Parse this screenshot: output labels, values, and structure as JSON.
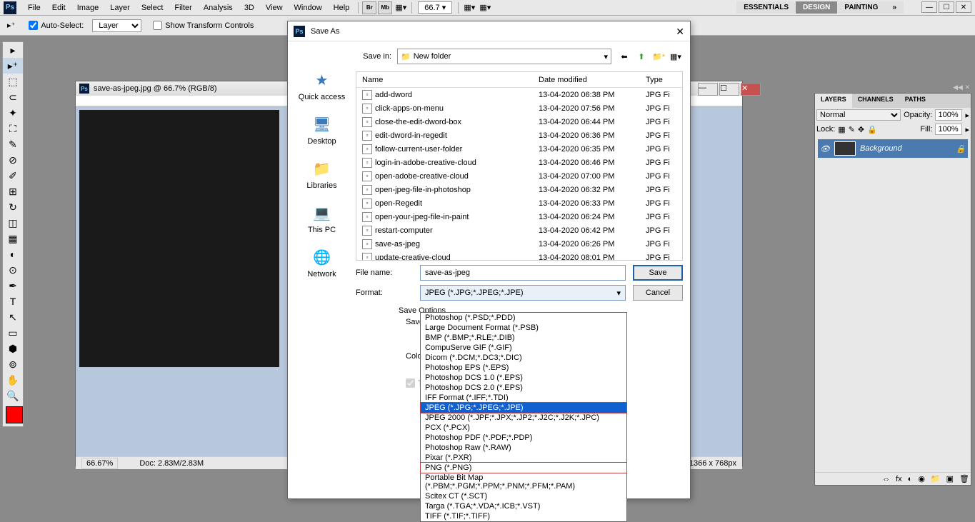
{
  "app": {
    "logo": "Ps"
  },
  "menu": [
    "File",
    "Edit",
    "Image",
    "Layer",
    "Select",
    "Filter",
    "Analysis",
    "3D",
    "View",
    "Window",
    "Help"
  ],
  "zoom": "66.7",
  "workspaces": [
    "ESSENTIALS",
    "DESIGN",
    "PAINTING"
  ],
  "options": {
    "auto_select": "Auto-Select:",
    "auto_select_val": "Layer",
    "show_transform": "Show Transform Controls"
  },
  "doc": {
    "title": "save-as-jpeg.jpg @ 66.7% (RGB/8)",
    "zoom": "66.67%",
    "size": "Doc: 2.83M/2.83M",
    "dims": "1366 x 768px"
  },
  "panels": {
    "tabs": [
      "LAYERS",
      "CHANNELS",
      "PATHS"
    ],
    "blend": "Normal",
    "opacity_lbl": "Opacity:",
    "opacity_val": "100%",
    "lock_lbl": "Lock:",
    "fill_lbl": "Fill:",
    "fill_val": "100%",
    "layer": "Background"
  },
  "dialog": {
    "title": "Save As",
    "savein_lbl": "Save in:",
    "savein_val": "New folder",
    "nav": [
      "Quick access",
      "Desktop",
      "Libraries",
      "This PC",
      "Network"
    ],
    "headers": {
      "name": "Name",
      "date": "Date modified",
      "type": "Type"
    },
    "files": [
      {
        "n": "add-dword",
        "d": "13-04-2020 06:38 PM",
        "t": "JPG Fi"
      },
      {
        "n": "click-apps-on-menu",
        "d": "13-04-2020 07:56 PM",
        "t": "JPG Fi"
      },
      {
        "n": "close-the-edit-dword-box",
        "d": "13-04-2020 06:44 PM",
        "t": "JPG Fi"
      },
      {
        "n": "edit-dword-in-regedit",
        "d": "13-04-2020 06:36 PM",
        "t": "JPG Fi"
      },
      {
        "n": "follow-current-user-folder",
        "d": "13-04-2020 06:35 PM",
        "t": "JPG Fi"
      },
      {
        "n": "login-in-adobe-creative-cloud",
        "d": "13-04-2020 06:46 PM",
        "t": "JPG Fi"
      },
      {
        "n": "open-adobe-creative-cloud",
        "d": "13-04-2020 07:00 PM",
        "t": "JPG Fi"
      },
      {
        "n": "open-jpeg-file-in-photoshop",
        "d": "13-04-2020 06:32 PM",
        "t": "JPG Fi"
      },
      {
        "n": "open-Regedit",
        "d": "13-04-2020 06:33 PM",
        "t": "JPG Fi"
      },
      {
        "n": "open-your-jpeg-file-in-paint",
        "d": "13-04-2020 06:24 PM",
        "t": "JPG Fi"
      },
      {
        "n": "restart-computer",
        "d": "13-04-2020 06:42 PM",
        "t": "JPG Fi"
      },
      {
        "n": "save-as-jpeg",
        "d": "13-04-2020 06:26 PM",
        "t": "JPG Fi"
      },
      {
        "n": "update-creative-cloud",
        "d": "13-04-2020 08:01 PM",
        "t": "JPG Fi"
      }
    ],
    "filename_lbl": "File name:",
    "filename_val": "save-as-jpeg",
    "format_lbl": "Format:",
    "format_val": "JPEG (*.JPG;*.JPEG;*.JPE)",
    "save_btn": "Save",
    "cancel_btn": "Cancel",
    "save_options": "Save Options",
    "save_lbl": "Save:",
    "color_lbl": "Color:",
    "thumbnail": "Thumbnail"
  },
  "formats": [
    "Photoshop (*.PSD;*.PDD)",
    "Large Document Format (*.PSB)",
    "BMP (*.BMP;*.RLE;*.DIB)",
    "CompuServe GIF (*.GIF)",
    "Dicom (*.DCM;*.DC3;*.DIC)",
    "Photoshop EPS (*.EPS)",
    "Photoshop DCS 1.0 (*.EPS)",
    "Photoshop DCS 2.0 (*.EPS)",
    "IFF Format (*.IFF;*.TDI)",
    "JPEG (*.JPG;*.JPEG;*.JPE)",
    "JPEG 2000 (*.JPF;*.JPX;*.JP2;*.J2C;*.J2K;*.JPC)",
    "PCX (*.PCX)",
    "Photoshop PDF (*.PDF;*.PDP)",
    "Photoshop Raw (*.RAW)",
    "Pixar (*.PXR)",
    "PNG (*.PNG)",
    "Portable Bit Map (*.PBM;*.PGM;*.PPM;*.PNM;*.PFM;*.PAM)",
    "Scitex CT (*.SCT)",
    "Targa (*.TGA;*.VDA;*.ICB;*.VST)",
    "TIFF (*.TIF;*.TIFF)"
  ]
}
